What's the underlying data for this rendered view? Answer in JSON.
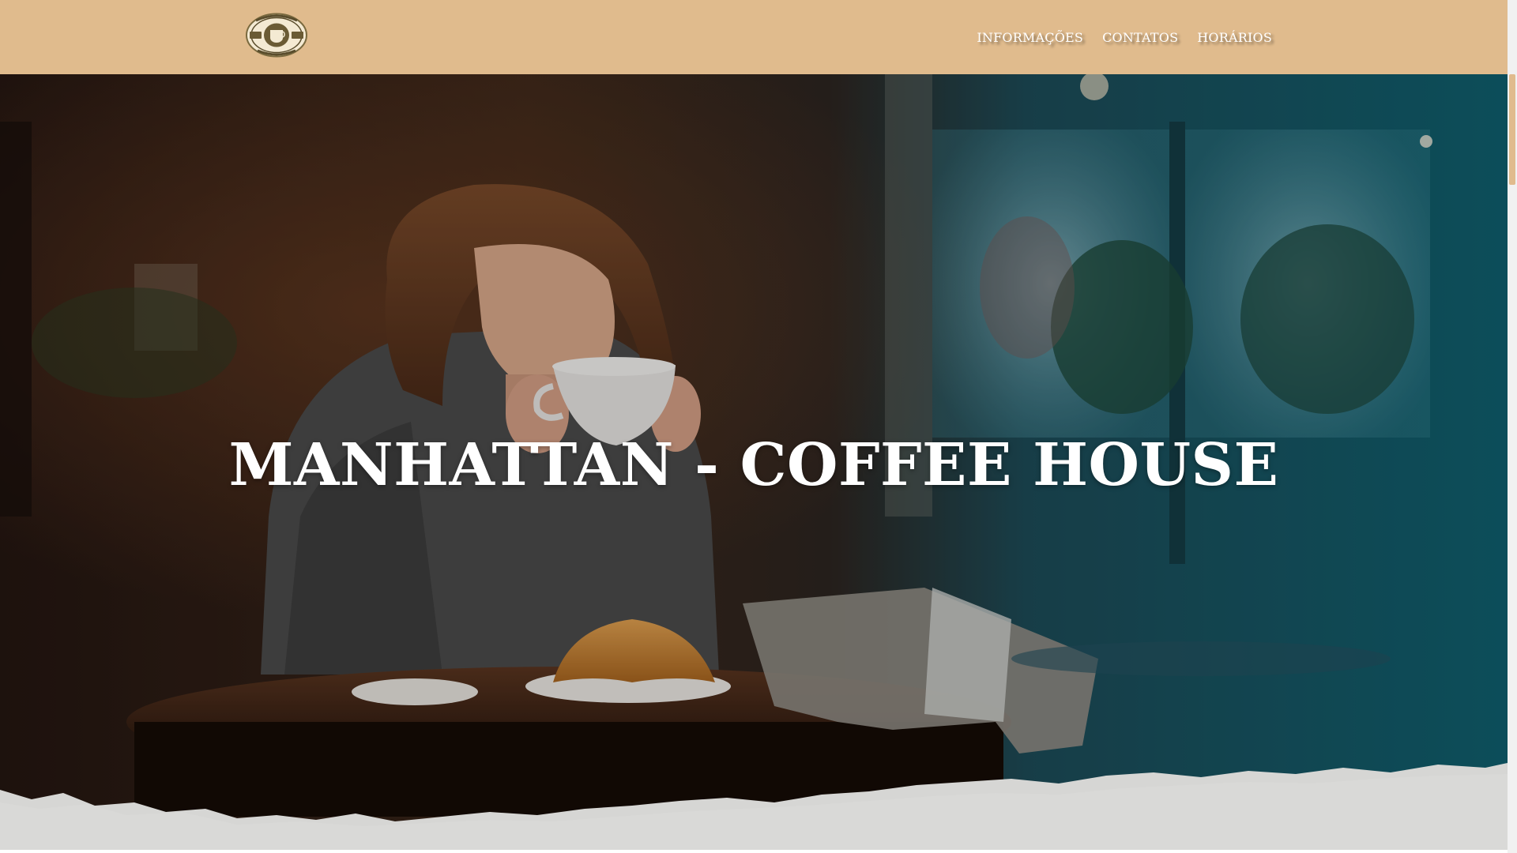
{
  "header": {
    "logo_name": "manhattan-coffee-seal",
    "nav": [
      {
        "label": "INFORMAÇÕES"
      },
      {
        "label": "CONTATOS"
      },
      {
        "label": "HORÁRIOS"
      }
    ]
  },
  "hero": {
    "title": "MANHATTAN - COFFEE HOUSE",
    "photo_description_icon": "coffee-shop-photo"
  },
  "colors": {
    "header_bg": "#e0bb8d",
    "hero_title": "#ffffff",
    "torn_edge": "#d6d6d4",
    "accent_teal": "#1f6f7d",
    "warm_brown": "#3a2417"
  }
}
